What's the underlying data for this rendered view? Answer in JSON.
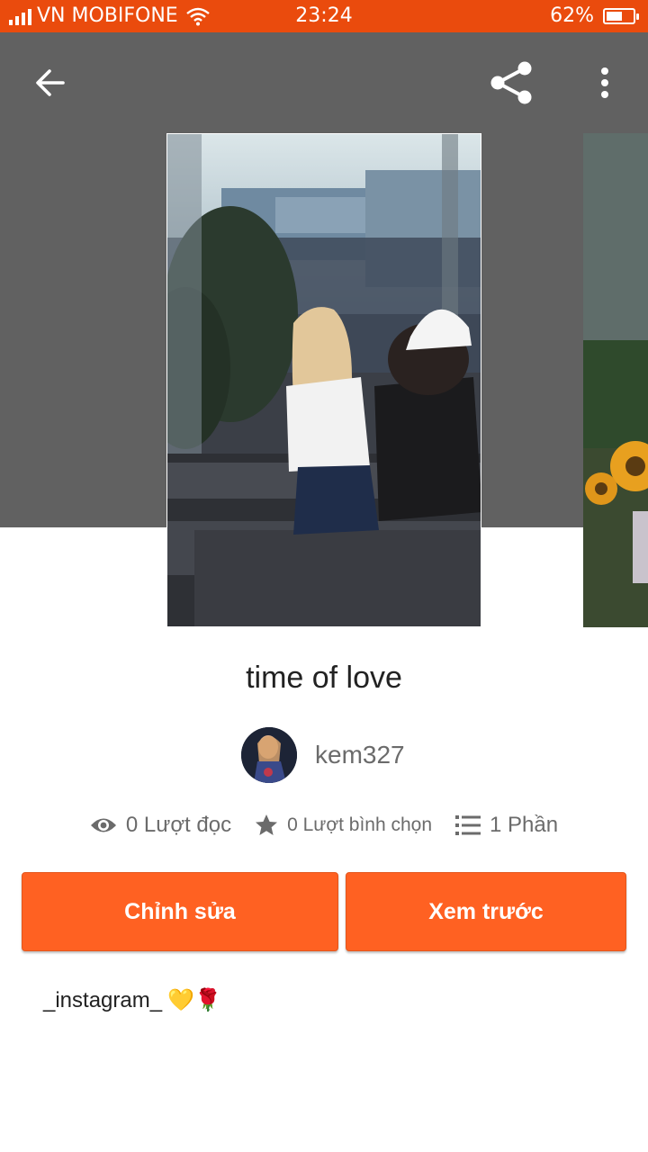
{
  "status_bar": {
    "carrier": "VN MOBIFONE",
    "time": "23:24",
    "battery": "62%",
    "battery_level": 0.62,
    "signal_icon": "signal-bars-icon",
    "wifi_icon": "wifi-icon"
  },
  "toolbar": {
    "back_icon": "arrow-left-icon",
    "share_icon": "share-icon",
    "more_icon": "more-vertical-icon"
  },
  "story": {
    "title": "time of love",
    "author": "kem327",
    "stats": {
      "reads": "0 Lượt đọc",
      "votes": "0 Lượt bình chọn",
      "parts": "1 Phần"
    }
  },
  "actions": {
    "edit_label": "Chỉnh sửa",
    "preview_label": "Xem trước"
  },
  "description": {
    "text": "_instagram_",
    "emoji": "💛🌹"
  },
  "colors": {
    "status_bar": "#ea4b0d",
    "header": "#616161",
    "accent": "#ff6122"
  }
}
